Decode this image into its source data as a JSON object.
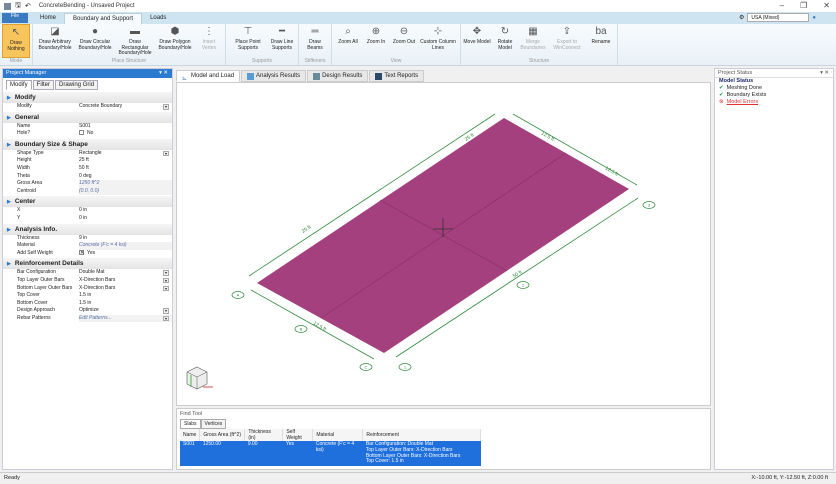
{
  "title": "ConcreteBending - Unsaved Project",
  "window_controls": [
    "–",
    "❐",
    "✕"
  ],
  "file_button": "File",
  "ribbon_tabs": [
    "Home",
    "Boundary and Support",
    "Loads"
  ],
  "active_ribbon_tab": 1,
  "region": "USA (Mixed)",
  "ribbon_groups": [
    {
      "label": "Mode",
      "buttons": [
        {
          "label": "Draw Nothing",
          "icon": "draw-nothing-icon",
          "state": "active"
        }
      ]
    },
    {
      "label": "Place Structure",
      "buttons": [
        {
          "label": "Draw Arbitrary Boundary/Hole",
          "icon": "arbitrary-boundary-icon"
        },
        {
          "label": "Draw Circular Boundary/Hole",
          "icon": "circular-boundary-icon"
        },
        {
          "label": "Draw Rectangular Boundary/Hole",
          "icon": "rectangular-boundary-icon"
        },
        {
          "label": "Draw Polygon Boundary/Hole",
          "icon": "polygon-boundary-icon"
        },
        {
          "label": "Insert Vertex",
          "icon": "insert-vertex-icon",
          "state": "disabled"
        }
      ]
    },
    {
      "label": "Supports",
      "buttons": [
        {
          "label": "Place Point Supports",
          "icon": "point-support-icon"
        },
        {
          "label": "Draw Line Supports",
          "icon": "line-support-icon"
        }
      ]
    },
    {
      "label": "Stiffeners",
      "buttons": [
        {
          "label": "Draw Beams",
          "icon": "beam-icon"
        }
      ]
    },
    {
      "label": "View",
      "buttons": [
        {
          "label": "Zoom All",
          "icon": "zoom-all-icon"
        },
        {
          "label": "Zoom In",
          "icon": "zoom-in-icon"
        },
        {
          "label": "Zoom Out",
          "icon": "zoom-out-icon"
        },
        {
          "label": "Custom Column Lines",
          "icon": "column-lines-icon"
        }
      ]
    },
    {
      "label": "Structure",
      "buttons": [
        {
          "label": "Move Model",
          "icon": "move-icon"
        },
        {
          "label": "Rotate Model",
          "icon": "rotate-icon"
        },
        {
          "label": "Merge Boundaries",
          "icon": "merge-icon",
          "state": "disabled"
        },
        {
          "label": "Export to WinConnect",
          "icon": "export-icon",
          "state": "disabled"
        },
        {
          "label": "Rename",
          "icon": "rename-icon"
        }
      ]
    }
  ],
  "project_manager": {
    "title": "Project Manager",
    "tabs": [
      "Modify",
      "Filter",
      "Drawing Grid"
    ],
    "sections": [
      {
        "title": "Modify",
        "rows": [
          {
            "k": "Modify",
            "v": "Concrete Boundary",
            "dd": true
          }
        ]
      },
      {
        "title": "General",
        "rows": [
          {
            "k": "Name",
            "v": "S001"
          },
          {
            "k": "Hole?",
            "v": "No",
            "check": ""
          }
        ]
      },
      {
        "title": "Boundary Size & Shape",
        "rows": [
          {
            "k": "Shape Type",
            "v": "Rectangle",
            "dd": true
          },
          {
            "k": "Height",
            "v": "25 ft"
          },
          {
            "k": "Width",
            "v": "50 ft"
          },
          {
            "k": "Theta",
            "v": "0 deg"
          },
          {
            "k": "Gross Area",
            "v": "1250 ft^2",
            "ro": true
          },
          {
            "k": "Centroid",
            "v": "(0.0, 0.0)",
            "ro": true
          }
        ]
      },
      {
        "title": "Center",
        "rows": [
          {
            "k": "X",
            "v": "0 in"
          },
          {
            "k": "Y",
            "v": "0 in"
          }
        ]
      },
      {
        "title": "Analysis Info.",
        "rows": [
          {
            "k": "Thickness",
            "v": "9 in"
          },
          {
            "k": "Material",
            "v": "Concrete (F'c = 4 ksi)",
            "ro": true
          },
          {
            "k": "Add Self Weight",
            "v": "Yes",
            "check": "✕"
          }
        ]
      },
      {
        "title": "Reinforcement Details",
        "rows": [
          {
            "k": "Bar Configuration",
            "v": "Double Mat",
            "dd": true
          },
          {
            "k": "Top Layer Outer Bars",
            "v": "X-Direction Bars",
            "dd": true
          },
          {
            "k": "Bottom Layer Outer Bars",
            "v": "X-Direction Bars",
            "dd": true
          },
          {
            "k": "Top Cover",
            "v": "1.5 in"
          },
          {
            "k": "Bottom Cover",
            "v": "1.5 in"
          },
          {
            "k": "Design Approach",
            "v": "Optimize",
            "dd": true
          },
          {
            "k": "Rebar Patterns",
            "v": "Edit Patterns...",
            "ro": true,
            "dd": true
          }
        ]
      }
    ]
  },
  "view_tabs": [
    "Model and Load",
    "Analysis Results",
    "Design Results",
    "Text Reports"
  ],
  "model": {
    "dims": {
      "top_left": "25 ft",
      "bottom_left": "25 ft",
      "top_right_a": "12.5 ft",
      "top_right_b": "12.5 ft",
      "right": "50 ft",
      "bottom": "12.5 ft"
    },
    "grid_labels": [
      "A",
      "B",
      "C",
      "1",
      "2",
      "3"
    ],
    "slab_color": "#a3407d",
    "dim_color": "#2e8b3a"
  },
  "find_tool": {
    "title": "Find Tool",
    "tabs": [
      "Slabs",
      "Vertices"
    ],
    "columns": [
      "Name",
      "Gross Area (ft^2)",
      "Thickness (in)",
      "Self Weight",
      "Material",
      "Reinforcement"
    ],
    "rows": [
      {
        "name": "S001",
        "area": "1250.00",
        "thickness": "9.00",
        "self_weight": "Yes",
        "material": "Concrete (F'c = 4 ksi)",
        "reinforcement": [
          "Bar Configuration: Double Mat",
          "Top Layer Outer Bars: X-Direction Bars",
          "Bottom Layer Outer Bars: X-Direction Bars",
          "Top Cover: 1.5 in"
        ]
      }
    ]
  },
  "project_status": {
    "title": "Project Status",
    "heading": "Model Status",
    "items": [
      {
        "text": "Meshing Done",
        "ok": true
      },
      {
        "text": "Boundary Exists",
        "ok": true
      },
      {
        "text": "Model Errors",
        "ok": false
      }
    ]
  },
  "status": {
    "left": "Ready",
    "coords": "X:-10.00 ft, Y:-12.50 ft, Z:0.00 ft"
  }
}
